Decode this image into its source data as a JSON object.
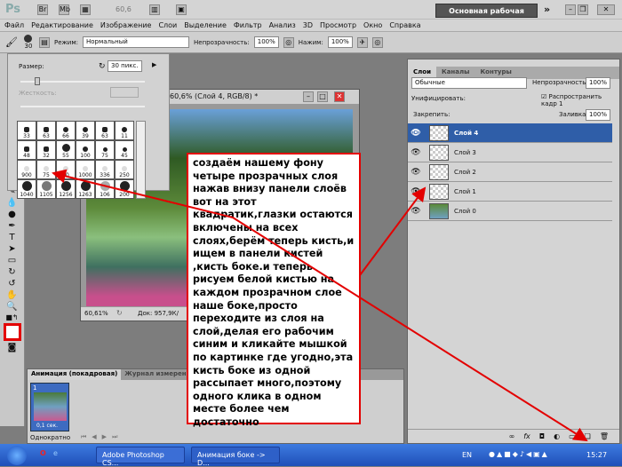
{
  "titlebar": {
    "logo": "Ps",
    "zoom": "60,6",
    "workspace": "Основная рабочая среда",
    "more": "»"
  },
  "menu": [
    "Файл",
    "Редактирование",
    "Изображение",
    "Слои",
    "Выделение",
    "Фильтр",
    "Анализ",
    "3D",
    "Просмотр",
    "Окно",
    "Справка"
  ],
  "options": {
    "brush_size": "30",
    "mode_label": "Режим:",
    "mode_value": "Нормальный",
    "opacity_label": "Непрозрачность:",
    "opacity_value": "100%",
    "flow_label": "Нажим:",
    "flow_value": "100%"
  },
  "brush_picker": {
    "size_label": "Размер:",
    "size_value": "30 пикс.",
    "hardness_label": "Жесткость:",
    "brushes": [
      "33",
      "63",
      "66",
      "39",
      "63",
      "11",
      "48",
      "32",
      "55",
      "100",
      "75",
      "45",
      "900",
      "75",
      "70",
      "1000",
      "336",
      "250",
      "1040",
      "1105",
      "1256",
      "1263",
      "106",
      "200"
    ]
  },
  "document": {
    "title": "60,6% (Слой 4, RGB/8) *",
    "zoom": "60,61%",
    "doc_info": "Док: 957,9К/"
  },
  "note": "создаём нашему фону четыре прозрачных слоя нажав внизу панели слоёв вот на этот квадратик,глазки остаются включены на всех слоях,берём теперь кисть,и ищем  в панели кистей ,кисть боке.и теперь рисуем белой кистью на каждом прозрачном слое наше боке,просто переходите из слоя на слой,делая его рабочим синим и кликайте мышкой по картинке где угодно,эта кисть боке из одной рассыпает много,поэтому одного клика в одном месте более чем достаточно",
  "layers_panel": {
    "tabs": [
      "Слои",
      "Каналы",
      "Контуры"
    ],
    "blend": "Обычные",
    "opacity_label": "Непрозрачность:",
    "opacity_value": "100%",
    "unify_label": "Унифицировать:",
    "propagate_label": "Распространить кадр 1",
    "propagate_checked": true,
    "lock_label": "Закрепить:",
    "fill_label": "Заливка:",
    "fill_value": "100%",
    "layers": [
      {
        "name": "Слой 4",
        "selected": true
      },
      {
        "name": "Слой 3"
      },
      {
        "name": "Слой 2"
      },
      {
        "name": "Слой 1"
      },
      {
        "name": "Слой 0"
      }
    ]
  },
  "animation": {
    "tabs": [
      "Анимация (покадровая)",
      "Журнал измерений"
    ],
    "frame_number": "1",
    "frame_delay": "0,1 сек.",
    "loop": "Однократно"
  },
  "taskbar": {
    "tasks": [
      "Adobe Photoshop CS...",
      "Анимация боке -> D..."
    ],
    "lang": "EN",
    "time": "15:27"
  },
  "colors": {
    "accent": "#2f5ea8",
    "annotation": "#e30000"
  }
}
